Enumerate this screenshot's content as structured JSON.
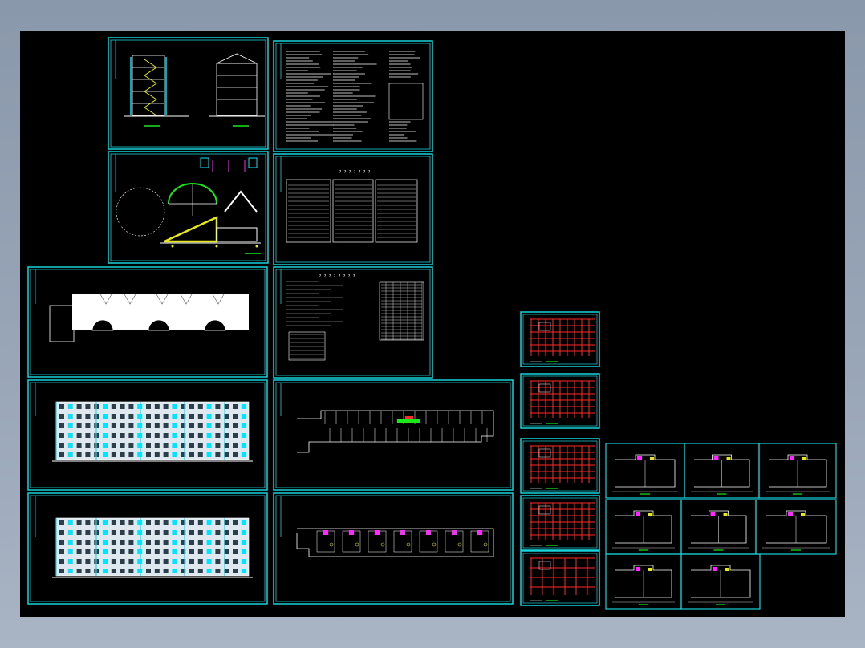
{
  "viewer": {
    "background": "#000000",
    "frame_color": "#19d2dc",
    "accent_colors": [
      "#ff2a2a",
      "#e8e81a",
      "#1ae81a",
      "#ff2aff",
      "#00e5ff",
      "#ffffff"
    ]
  },
  "sheets": [
    {
      "id": "s1",
      "kind": "elevation-section",
      "title": ""
    },
    {
      "id": "s2",
      "kind": "design-notes",
      "title": ""
    },
    {
      "id": "s3",
      "kind": "roof-details",
      "title": ""
    },
    {
      "id": "s4",
      "kind": "door-window-schedule",
      "title": "? ? ? ? ? ? ?"
    },
    {
      "id": "s5",
      "kind": "roof-plan",
      "title": ""
    },
    {
      "id": "s6",
      "kind": "schedule-tables",
      "title": "? ? ? ? ? ? ? ?"
    },
    {
      "id": "s7",
      "kind": "front-elevation",
      "title": ""
    },
    {
      "id": "s8",
      "kind": "floor-plan",
      "title": ""
    },
    {
      "id": "s9",
      "kind": "rear-elevation",
      "title": ""
    },
    {
      "id": "s10",
      "kind": "floor-plan",
      "title": ""
    },
    {
      "id": "s11",
      "kind": "structural-grid",
      "title": ""
    },
    {
      "id": "s12",
      "kind": "structural-grid",
      "title": ""
    },
    {
      "id": "s13",
      "kind": "structural-grid",
      "title": ""
    },
    {
      "id": "s14",
      "kind": "structural-grid",
      "title": ""
    },
    {
      "id": "s15",
      "kind": "structural-grid",
      "title": ""
    },
    {
      "id": "s16",
      "kind": "unit-plan",
      "title": ""
    },
    {
      "id": "s17",
      "kind": "unit-plan",
      "title": ""
    },
    {
      "id": "s18",
      "kind": "unit-plan",
      "title": ""
    },
    {
      "id": "s19",
      "kind": "unit-plan",
      "title": ""
    },
    {
      "id": "s20",
      "kind": "unit-plan",
      "title": ""
    },
    {
      "id": "s21",
      "kind": "unit-plan",
      "title": ""
    },
    {
      "id": "s22",
      "kind": "unit-plan",
      "title": ""
    },
    {
      "id": "s23",
      "kind": "unit-plan",
      "title": ""
    }
  ]
}
